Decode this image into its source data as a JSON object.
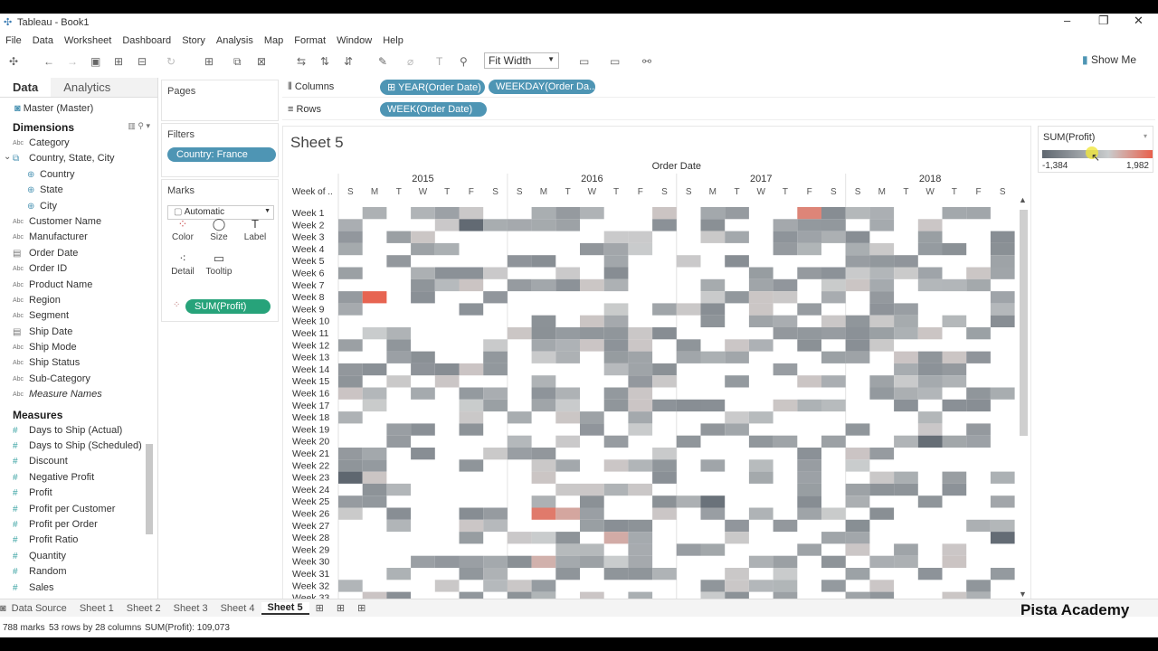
{
  "window": {
    "title": "Tableau - Book1"
  },
  "menu": [
    "File",
    "Data",
    "Worksheet",
    "Dashboard",
    "Story",
    "Analysis",
    "Map",
    "Format",
    "Window",
    "Help"
  ],
  "toolbar": {
    "fit": "Fit Width",
    "show_me": "Show Me"
  },
  "left_tabs": {
    "data": "Data",
    "analytics": "Analytics"
  },
  "datasource": "Master (Master)",
  "dimensions_label": "Dimensions",
  "dimensions": [
    {
      "label": "Category",
      "type": "Abc"
    },
    {
      "label": "Country, State, City",
      "type": "geo-group"
    },
    {
      "label": "Country",
      "type": "geo",
      "sub": true
    },
    {
      "label": "State",
      "type": "geo",
      "sub": true
    },
    {
      "label": "City",
      "type": "geo",
      "sub": true
    },
    {
      "label": "Customer Name",
      "type": "Abc"
    },
    {
      "label": "Manufacturer",
      "type": "Abc"
    },
    {
      "label": "Order Date",
      "type": "date"
    },
    {
      "label": "Order ID",
      "type": "Abc"
    },
    {
      "label": "Product Name",
      "type": "Abc"
    },
    {
      "label": "Region",
      "type": "Abc"
    },
    {
      "label": "Segment",
      "type": "Abc"
    },
    {
      "label": "Ship Date",
      "type": "date"
    },
    {
      "label": "Ship Mode",
      "type": "Abc"
    },
    {
      "label": "Ship Status",
      "type": "Abc"
    },
    {
      "label": "Sub-Category",
      "type": "Abc"
    },
    {
      "label": "Measure Names",
      "type": "Abc",
      "italic": true
    }
  ],
  "measures_label": "Measures",
  "measures": [
    "Days to Ship (Actual)",
    "Days to Ship (Scheduled)",
    "Discount",
    "Negative Profit",
    "Profit",
    "Profit per Customer",
    "Profit per Order",
    "Profit Ratio",
    "Quantity",
    "Random",
    "Sales"
  ],
  "pages_label": "Pages",
  "filters_label": "Filters",
  "filter_pill": "Country: France",
  "marks_label": "Marks",
  "mark_type": "Automatic",
  "mark_buttons": [
    "Color",
    "Size",
    "Label",
    "Detail",
    "Tooltip"
  ],
  "marks_pill": "SUM(Profit)",
  "columns_label": "Columns",
  "rows_label": "Rows",
  "columns_pills": [
    "YEAR(Order Date)",
    "WEEKDAY(Order Da.."
  ],
  "rows_pills": [
    "WEEK(Order Date)"
  ],
  "sheet_title": "Sheet 5",
  "legend": {
    "title": "SUM(Profit)",
    "min": "-1,384",
    "max": "1,982"
  },
  "sheet_tabs": [
    "Data Source",
    "Sheet 1",
    "Sheet 2",
    "Sheet 3",
    "Sheet 4",
    "Sheet 5"
  ],
  "status": {
    "marks": "788 marks",
    "dims": "53 rows by 28 columns",
    "sum": "SUM(Profit): 109,073"
  },
  "watermark": "Pista Academy",
  "chart_data": {
    "type": "heatmap",
    "title": "Order Date",
    "years": [
      "2015",
      "2016",
      "2017",
      "2018"
    ],
    "weekdays": [
      "S",
      "M",
      "T",
      "W",
      "T",
      "F",
      "S"
    ],
    "row_header": "Week of ..",
    "rows": [
      "Week 1",
      "Week 2",
      "Week 3",
      "Week 4",
      "Week 5",
      "Week 6",
      "Week 7",
      "Week 8",
      "Week 9",
      "Week 10",
      "Week 11",
      "Week 12",
      "Week 13",
      "Week 14",
      "Week 15",
      "Week 16",
      "Week 17",
      "Week 18",
      "Week 19",
      "Week 20",
      "Week 21",
      "Week 22",
      "Week 23",
      "Week 24",
      "Week 25",
      "Week 26",
      "Week 27",
      "Week 28",
      "Week 29",
      "Week 30",
      "Week 31",
      "Week 32",
      "Week 33"
    ],
    "color_range": [
      -1384,
      1982
    ],
    "colors": {
      "low": "#5f6770",
      "mid": "#c9cccd",
      "high": "#e8604c"
    },
    "grid": "000000000000000000000000000000000000000000000000000000000000000000000000000000000000000000000000000000000000000000000000000000000000000000000000000000000000000000000000000000000000000000000000000000000000000000000000000000000000000000000000000000000000000000000000000000000000000000000000000000000000000000000000000000000000000000000000000000000000000000000000000000000000000000000000000000000000000000000000000000000000000000000000000000000000000000000000000000000000000000000000000000000000000000000000000000000000000000000000000000000000000000000000000000000000000000000000000000000000000000000000000000000000000000000000000000000000000000000000000000000000000000000000000000000000000000000000000000000000000000000000000000000000000000000000000000000000000000000000000000000000000000000000000000000000000000000000000000000000000000000000000000000000000000000000000000000000000000000000000000000000000000000000000000000000000000000000000000000000000000000000000000000000000000000000000000000000000000000000000000000000000000000000000000000000000000000000",
    "hot_cells": [
      {
        "year": "2015",
        "week": "Week 8",
        "day": 1,
        "value": 1900
      },
      {
        "year": "2016",
        "week": "Week 26",
        "day": 1,
        "value": 1500
      },
      {
        "year": "2016",
        "week": "Week 26",
        "day": 2,
        "value": 700
      },
      {
        "year": "2016",
        "week": "Week 28",
        "day": 4,
        "value": 600
      },
      {
        "year": "2016",
        "week": "Week 30",
        "day": 1,
        "value": 500
      },
      {
        "year": "2017",
        "week": "Week 1",
        "day": 5,
        "value": 1300
      }
    ],
    "cold_cells": [
      {
        "year": "2015",
        "week": "Week 2",
        "day": 5,
        "value": -1300
      },
      {
        "year": "2015",
        "week": "Week 23",
        "day": 0,
        "value": -1384
      },
      {
        "year": "2017",
        "week": "Week 25",
        "day": 1,
        "value": -1100
      },
      {
        "year": "2018",
        "week": "Week 20",
        "day": 3,
        "value": -1200
      },
      {
        "year": "2018",
        "week": "Week 28",
        "day": 6,
        "value": -1250
      }
    ]
  }
}
